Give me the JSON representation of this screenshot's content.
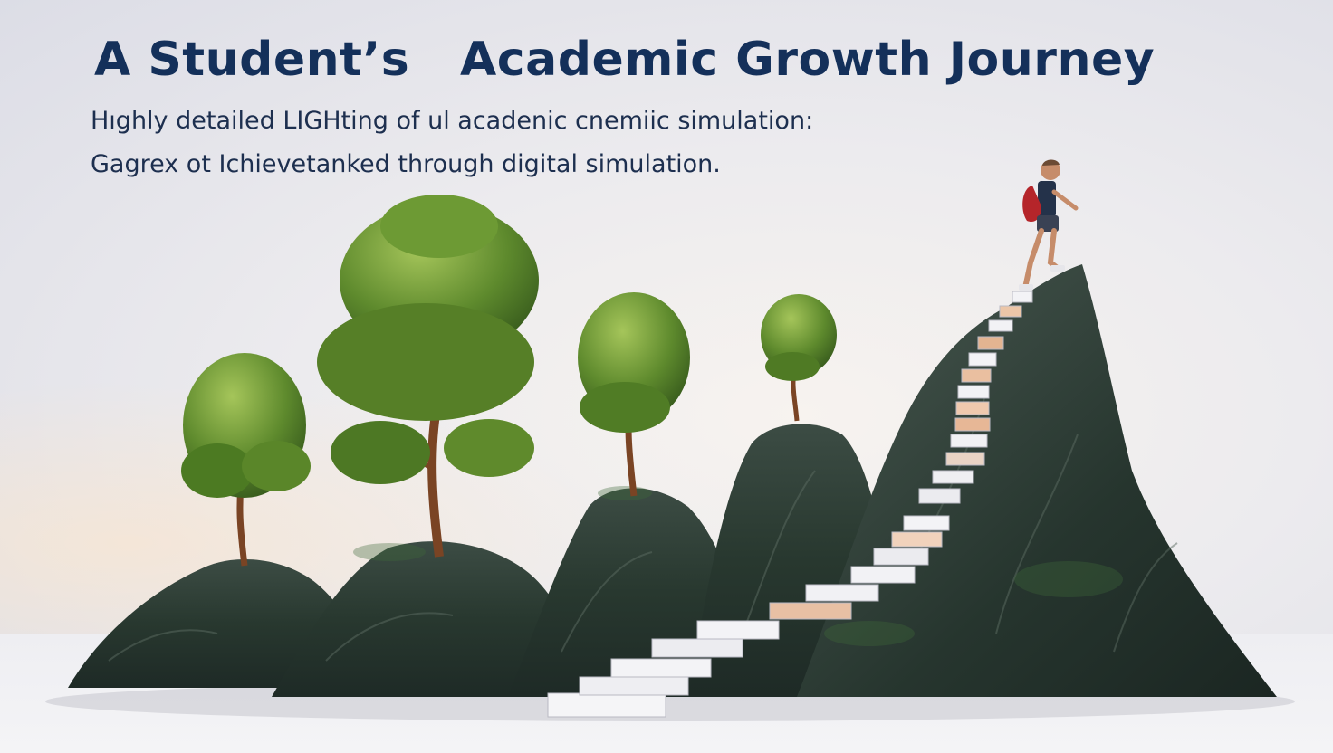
{
  "title": "A Student’s   Academic Growth Journey",
  "caption_lines": [
    "Hıghly detailed LIGHting of ul acadenic cnemiic simulation:",
    "Gagrex ot Ichievetanked through digital simulation."
  ],
  "colors": {
    "title": "#14305a",
    "caption": "#1d2f4f",
    "rock": "#2b3a35",
    "foliage": "#4f7a26",
    "backpack": "#b5252a"
  },
  "icons": [
    "tree",
    "rock-mountain",
    "staircase",
    "student-hiker"
  ]
}
